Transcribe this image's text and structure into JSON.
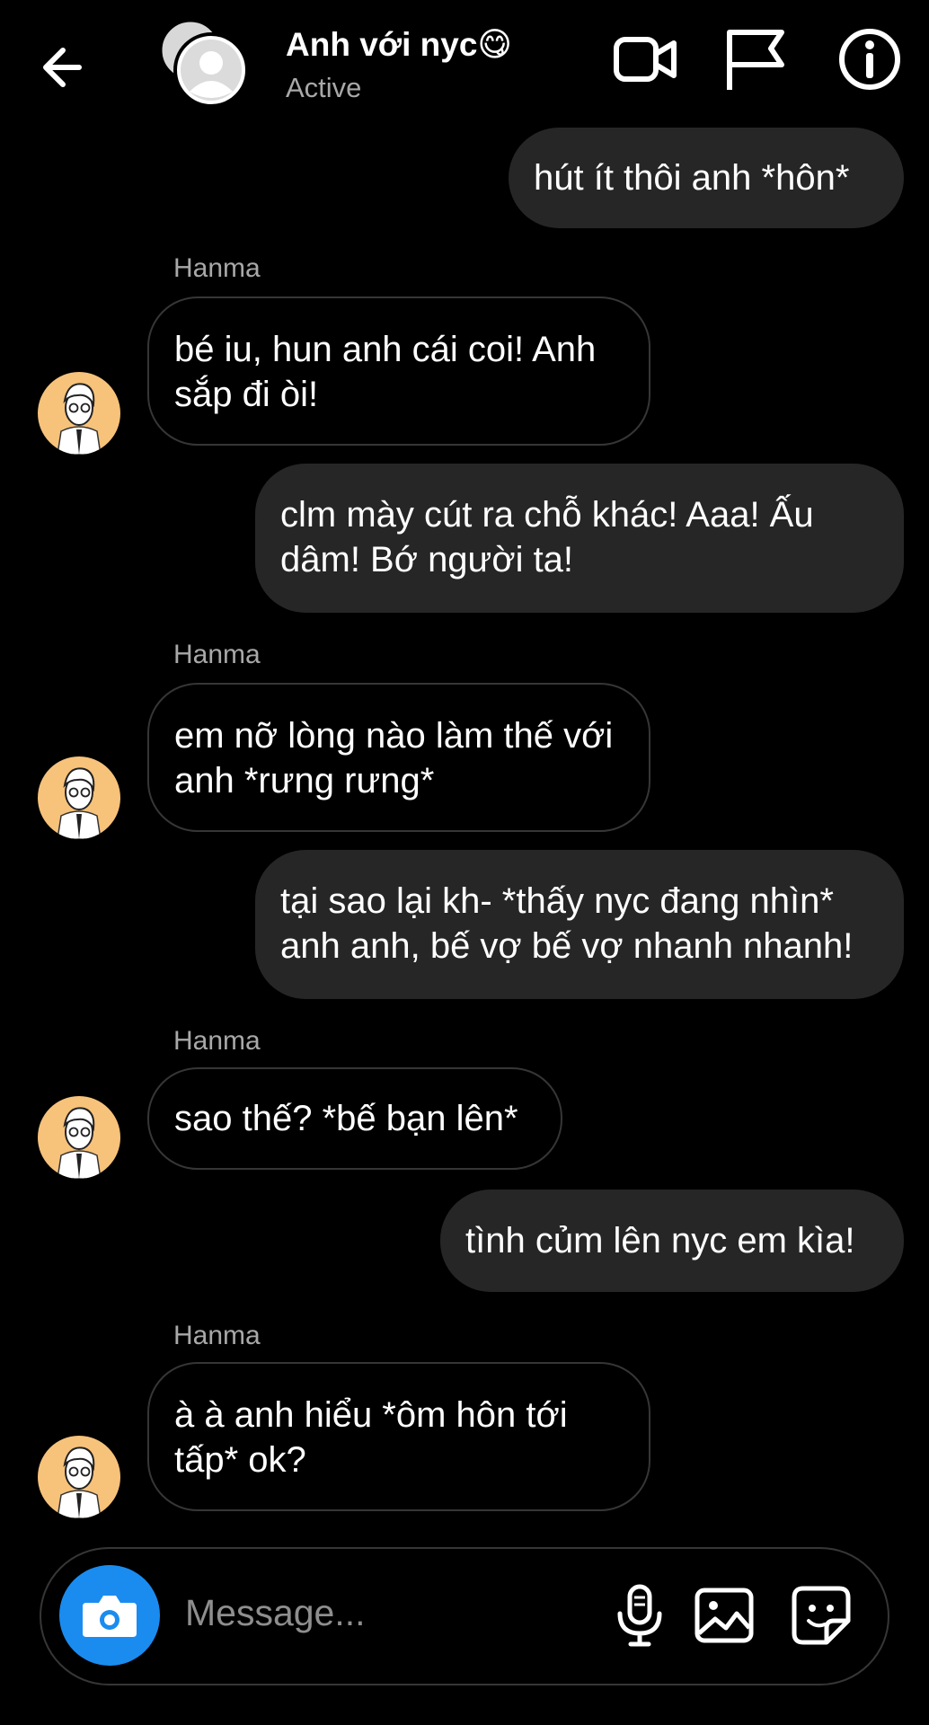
{
  "header": {
    "title": "Anh với nyc😋",
    "status": "Active",
    "icons": [
      "back-arrow-icon",
      "group-avatar-icon",
      "video-call-icon",
      "flag-icon",
      "info-icon"
    ]
  },
  "messages": [
    {
      "dir": "out",
      "text": "hút ít thôi anh *hôn*"
    },
    {
      "dir": "in",
      "sender": "Hanma",
      "text": "bé iu, hun anh cái coi! Anh sắp đi òi!"
    },
    {
      "dir": "out",
      "text": "clm mày cút ra chỗ khác! Aaa! Ấu dâm! Bớ người ta!"
    },
    {
      "dir": "in",
      "sender": "Hanma",
      "text": "em nỡ lòng nào làm thế với anh *rưng rưng*"
    },
    {
      "dir": "out",
      "text": "tại sao lại kh- *thấy nyc đang nhìn* anh anh, bế vợ bế vợ nhanh nhanh!"
    },
    {
      "dir": "in",
      "sender": "Hanma",
      "text": "sao thế? *bế bạn lên*"
    },
    {
      "dir": "out",
      "text": "tình củm lên nyc em kìa!"
    },
    {
      "dir": "in",
      "sender": "Hanma",
      "text": "à à anh hiểu *ôm hôn tới tấp* ok?"
    }
  ],
  "composer": {
    "placeholder": "Message...",
    "icons": [
      "camera-icon",
      "microphone-icon",
      "gallery-icon",
      "sticker-icon"
    ]
  },
  "colors": {
    "background": "#000000",
    "outgoing_bubble": "#262626",
    "incoming_border": "#363636",
    "camera_button": "#1a8cf0",
    "avatar_bg": "#f7c27a"
  }
}
